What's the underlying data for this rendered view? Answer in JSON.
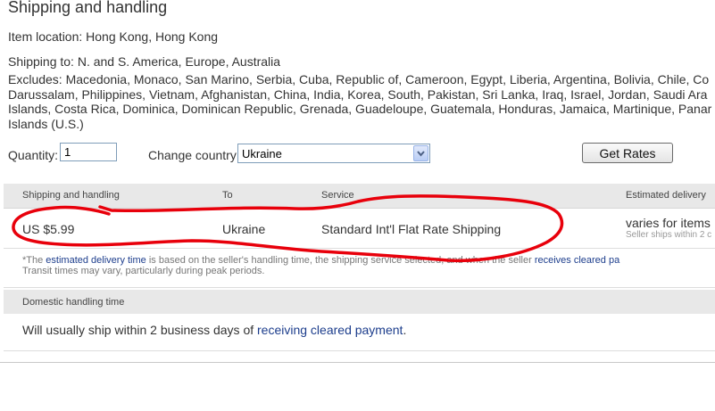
{
  "section_title": "Shipping and handling",
  "item_location": "Item location: Hong Kong, Hong Kong",
  "shipping_to": "Shipping to: N. and S. America, Europe, Australia",
  "excludes_lines": [
    "Excludes: Macedonia, Monaco, San Marino, Serbia, Cuba, Republic of, Cameroon, Egypt, Liberia, Argentina, Bolivia, Chile, Co",
    "Darussalam, Philippines, Vietnam, Afghanistan, China, India, Korea, South, Pakistan, Sri Lanka, Iraq, Israel, Jordan, Saudi Ara",
    "Islands, Costa Rica, Dominica, Dominican Republic, Grenada, Guadeloupe, Guatemala, Honduras, Jamaica, Martinique, Panar",
    "Islands (U.S.)"
  ],
  "quantity": {
    "label": "Quantity:",
    "value": "1"
  },
  "country": {
    "label": "Change country:",
    "selected": "Ukraine"
  },
  "get_rates_label": "Get Rates",
  "table": {
    "headers": {
      "shipping": "Shipping and handling",
      "to": "To",
      "service": "Service",
      "delivery": "Estimated delivery"
    },
    "row": {
      "price": "US $5.99",
      "to": "Ukraine",
      "service": "Standard Int'l Flat Rate Shipping",
      "delivery": "varies for items",
      "delivery_sub": "Seller ships within 2 c"
    }
  },
  "note": {
    "prefix": "*The ",
    "link1": "estimated delivery time",
    "middle": " is based on the seller's handling time, the shipping service selected, and when the seller ",
    "link2": "receives cleared pa",
    "line2": "Transit times may vary, particularly during peak periods."
  },
  "domestic": {
    "header": "Domestic handling time",
    "text_prefix": "Will usually ship within 2 business days of ",
    "link": "receiving cleared payment",
    "text_suffix": "."
  },
  "annotation_color": "#e8000b"
}
